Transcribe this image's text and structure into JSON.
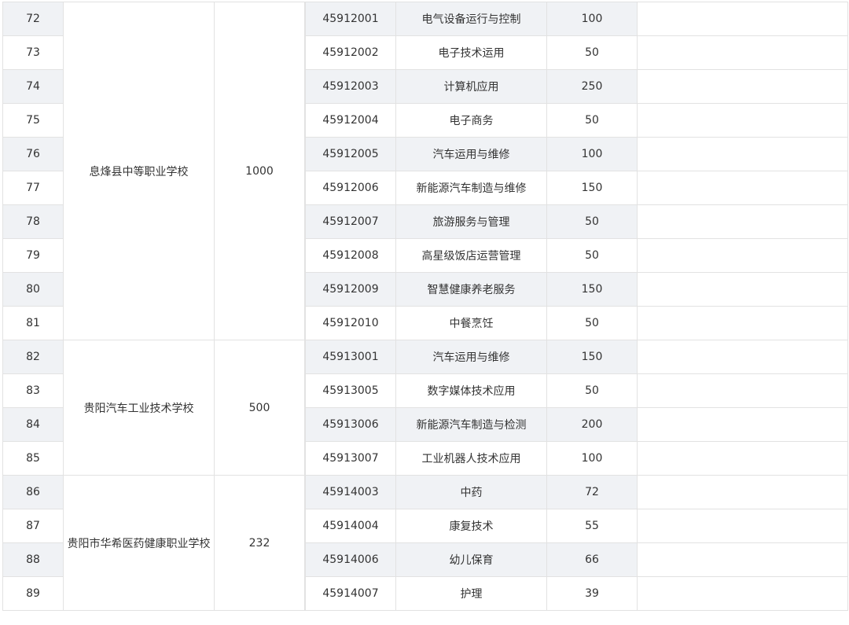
{
  "groups": [
    {
      "school": "息烽县中等职业学校",
      "total": "1000",
      "rows": [
        {
          "no": "72",
          "code": "45912001",
          "major": "电气设备运行与控制",
          "plan": "100"
        },
        {
          "no": "73",
          "code": "45912002",
          "major": "电子技术运用",
          "plan": "50"
        },
        {
          "no": "74",
          "code": "45912003",
          "major": "计算机应用",
          "plan": "250"
        },
        {
          "no": "75",
          "code": "45912004",
          "major": "电子商务",
          "plan": "50"
        },
        {
          "no": "76",
          "code": "45912005",
          "major": "汽车运用与维修",
          "plan": "100"
        },
        {
          "no": "77",
          "code": "45912006",
          "major": "新能源汽车制造与维修",
          "plan": "150"
        },
        {
          "no": "78",
          "code": "45912007",
          "major": "旅游服务与管理",
          "plan": "50"
        },
        {
          "no": "79",
          "code": "45912008",
          "major": "高星级饭店运营管理",
          "plan": "50"
        },
        {
          "no": "80",
          "code": "45912009",
          "major": "智慧健康养老服务",
          "plan": "150"
        },
        {
          "no": "81",
          "code": "45912010",
          "major": "中餐烹饪",
          "plan": "50"
        }
      ]
    },
    {
      "school": "贵阳汽车工业技术学校",
      "total": "500",
      "rows": [
        {
          "no": "82",
          "code": "45913001",
          "major": "汽车运用与维修",
          "plan": "150"
        },
        {
          "no": "83",
          "code": "45913005",
          "major": "数字媒体技术应用",
          "plan": "50"
        },
        {
          "no": "84",
          "code": "45913006",
          "major": "新能源汽车制造与检测",
          "plan": "200"
        },
        {
          "no": "85",
          "code": "45913007",
          "major": "工业机器人技术应用",
          "plan": "100"
        }
      ]
    },
    {
      "school": "贵阳市华希医药健康职业学校",
      "total": "232",
      "rows": [
        {
          "no": "86",
          "code": "45914003",
          "major": "中药",
          "plan": "72"
        },
        {
          "no": "87",
          "code": "45914004",
          "major": "康复技术",
          "plan": "55"
        },
        {
          "no": "88",
          "code": "45914006",
          "major": "幼儿保育",
          "plan": "66"
        },
        {
          "no": "89",
          "code": "45914007",
          "major": "护理",
          "plan": "39"
        }
      ]
    }
  ]
}
